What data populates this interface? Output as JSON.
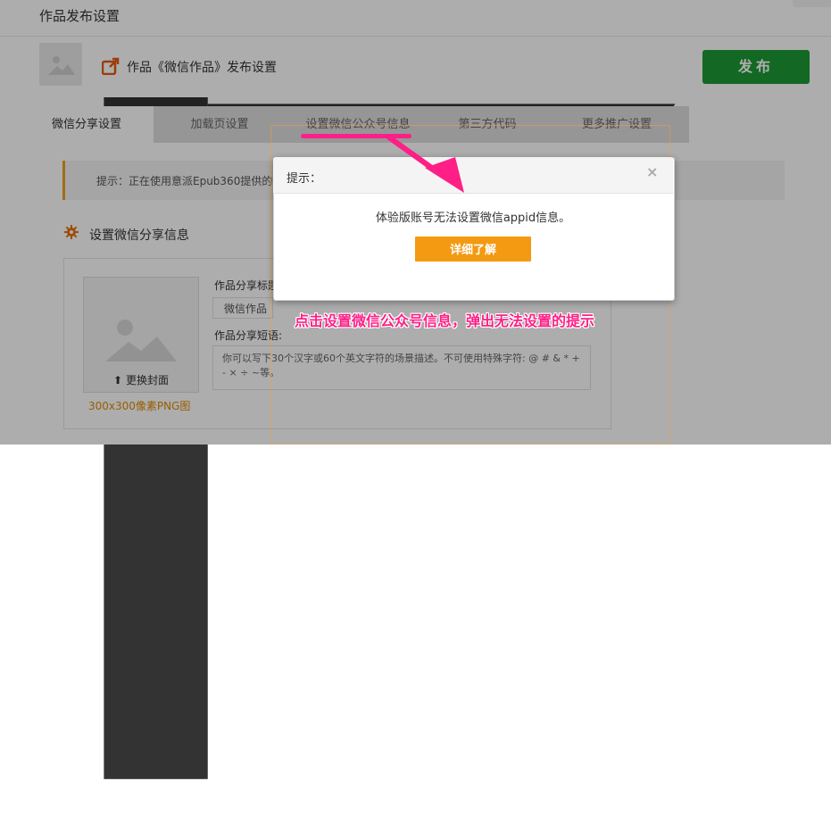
{
  "page": {
    "title": "作品发布设置"
  },
  "work": {
    "title": "作品《微信作品》发布设置",
    "publish_label": "发布"
  },
  "tabs": [
    {
      "label": "微信分享设置"
    },
    {
      "label": "加载页设置"
    },
    {
      "label": "设置微信公众号信息"
    },
    {
      "label": "第三方代码"
    },
    {
      "label": "更多推广设置"
    }
  ],
  "tip": {
    "text": "提示：正在使用意派Epub360提供的"
  },
  "share": {
    "section_title": "设置微信分享信息",
    "change_cover": "更换封面",
    "cover_size": "300x300像素PNG图",
    "title_label": "作品分享标题",
    "title_value": "微信作品",
    "desc_label": "作品分享短语:",
    "desc_placeholder": "你可以写下30个汉字或60个英文字符的场景描述。不可使用特殊字符: @ # & * + - × ÷ ~等。"
  },
  "modal": {
    "title": "提示：",
    "close_label": "×",
    "message": "体验版账号无法设置微信appid信息。",
    "learn_more": "详细了解"
  },
  "annotation": {
    "text": "点击设置微信公众号信息，弹出无法设置的提示"
  },
  "colors": {
    "publish": "#1c9a34",
    "accent": "#f39a12",
    "annotation": "#ff1f86"
  }
}
